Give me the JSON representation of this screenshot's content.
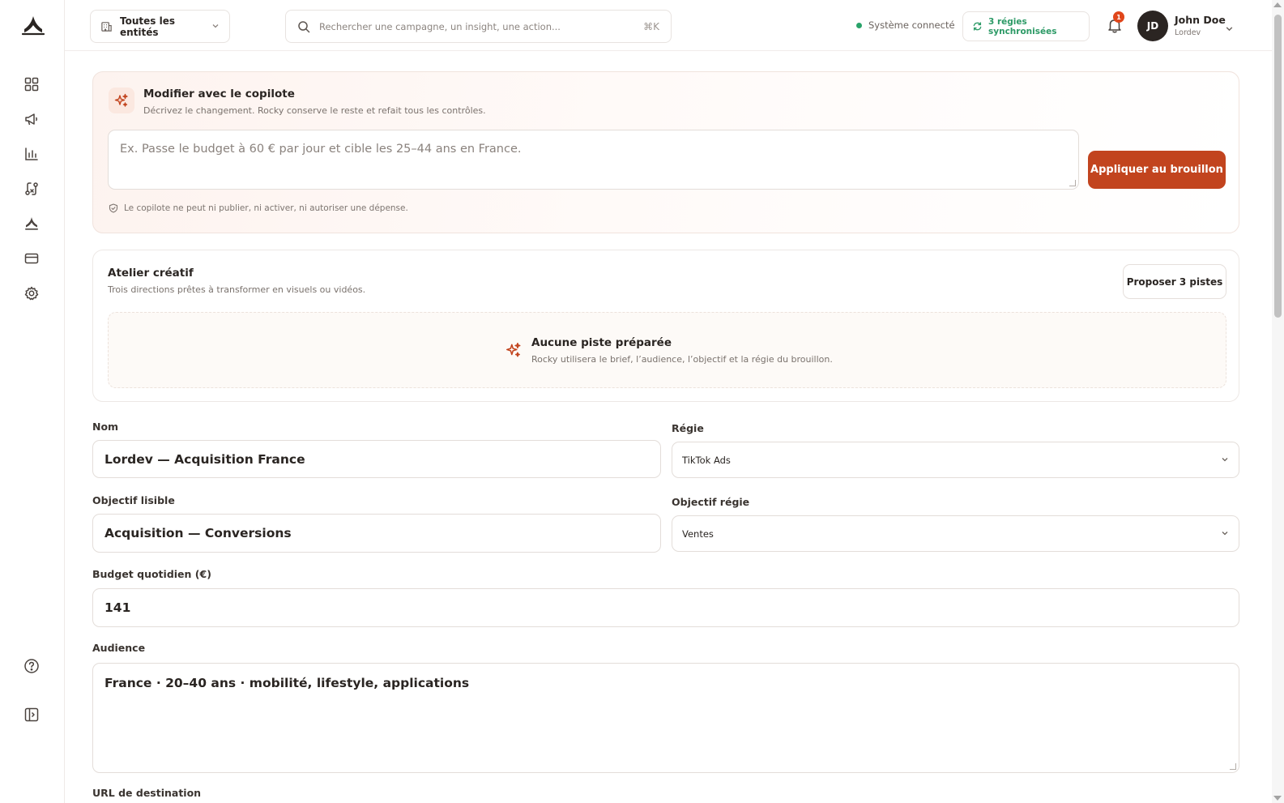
{
  "colors": {
    "accent": "#c2441e",
    "success": "#2c9a66",
    "badge": "#e0461b"
  },
  "sidebar": {
    "icons": [
      "dashboard-icon",
      "megaphone-icon",
      "bar-chart-icon",
      "rules-icon",
      "brand-icon",
      "card-icon",
      "gear-icon",
      "help-icon",
      "collapse-sidebar-icon"
    ]
  },
  "header": {
    "entity_selector": "Toutes les entités",
    "search_placeholder": "Rechercher une campagne, un insight, une action...",
    "search_shortcut": "⌘K",
    "system_status": "Système connecté",
    "sync_status": "3 régies synchronisées",
    "notification_count": "1",
    "user": {
      "initials": "JD",
      "name": "John Doe",
      "org": "Lordev"
    }
  },
  "copilot": {
    "title": "Modifier avec le copilote",
    "subtitle": "Décrivez le changement. Rocky conserve le reste et refait tous les contrôles.",
    "input_placeholder": "Ex. Passe le budget à 60 € par jour et cible les 25–44 ans en France.",
    "apply_label": "Appliquer au brouillon",
    "note": "Le copilote ne peut ni publier, ni activer, ni autoriser une dépense."
  },
  "atelier": {
    "title": "Atelier créatif",
    "subtitle": "Trois directions prêtes à transformer en visuels ou vidéos.",
    "propose_label": "Proposer 3 pistes",
    "empty_title": "Aucune piste préparée",
    "empty_subtitle": "Rocky utilisera le brief, l’audience, l’objectif et la régie du brouillon."
  },
  "form": {
    "name_label": "Nom",
    "name_value": "Lordev — Acquisition France",
    "platform_label": "Régie",
    "platform_value": "TikTok Ads",
    "objective_label": "Objectif lisible",
    "objective_value": "Acquisition — Conversions",
    "platform_objective_label": "Objectif régie",
    "platform_objective_value": "Ventes",
    "budget_label": "Budget quotidien (€)",
    "budget_value": "141",
    "audience_label": "Audience",
    "audience_value": "France · 20–40 ans · mobilité, lifestyle, applications",
    "url_label": "URL de destination"
  }
}
